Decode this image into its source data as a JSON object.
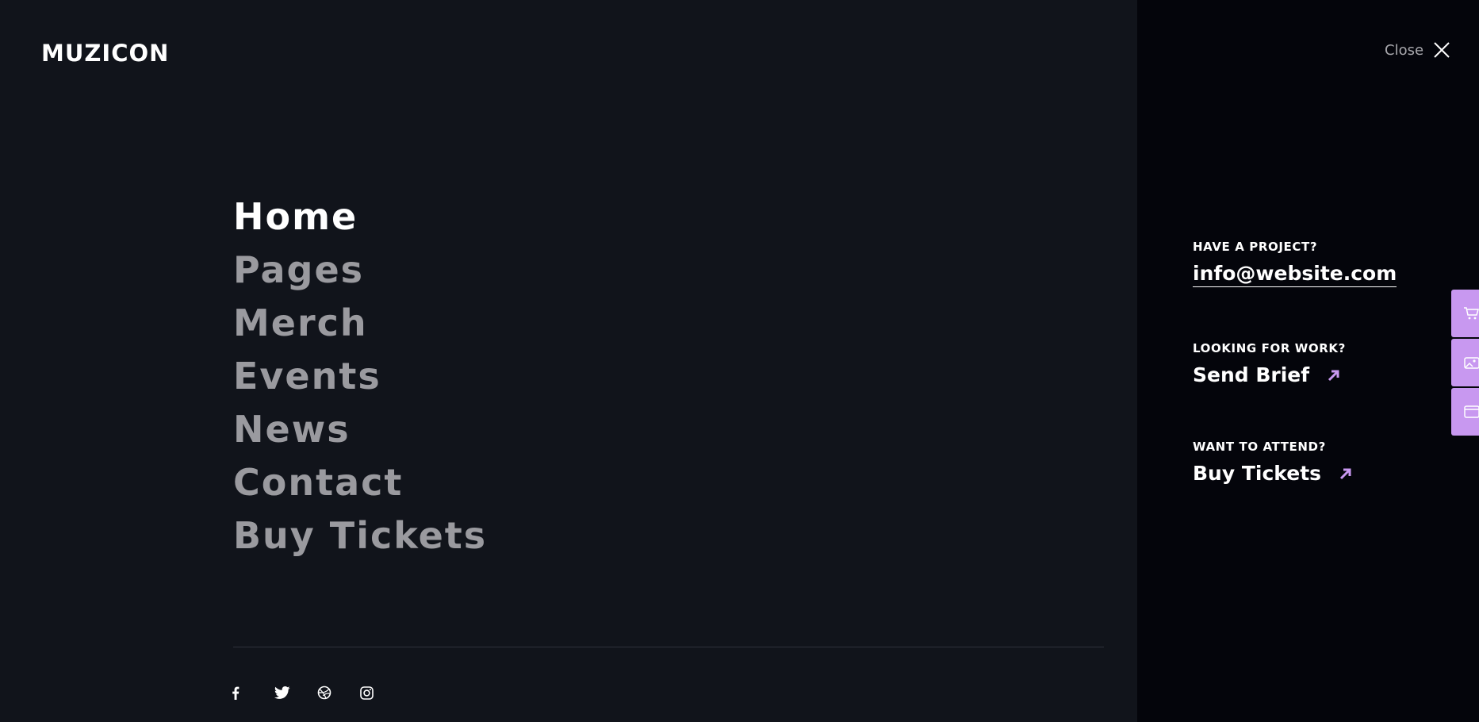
{
  "brand": {
    "logo": "MUZICON"
  },
  "close": {
    "label": "Close"
  },
  "menu": [
    {
      "label": "Home",
      "active": true
    },
    {
      "label": "Pages"
    },
    {
      "label": "Merch"
    },
    {
      "label": "Events"
    },
    {
      "label": "News"
    },
    {
      "label": "Contact"
    },
    {
      "label": "Buy Tickets"
    }
  ],
  "social": [
    "facebook-icon",
    "twitter-icon",
    "dribbble-icon",
    "instagram-icon"
  ],
  "contact": {
    "project_label": "HAVE A PROJECT?",
    "email": "info@website.com",
    "work_label": "LOOKING FOR WORK?",
    "work_link": "Send Brief",
    "attend_label": "WANT TO ATTEND?",
    "attend_link": "Buy Tickets"
  },
  "side_tabs": [
    "cart-icon",
    "image-icon",
    "window-icon"
  ],
  "colors": {
    "accent": "#c898f0",
    "background": "#11141b",
    "panel": "#04050b"
  }
}
